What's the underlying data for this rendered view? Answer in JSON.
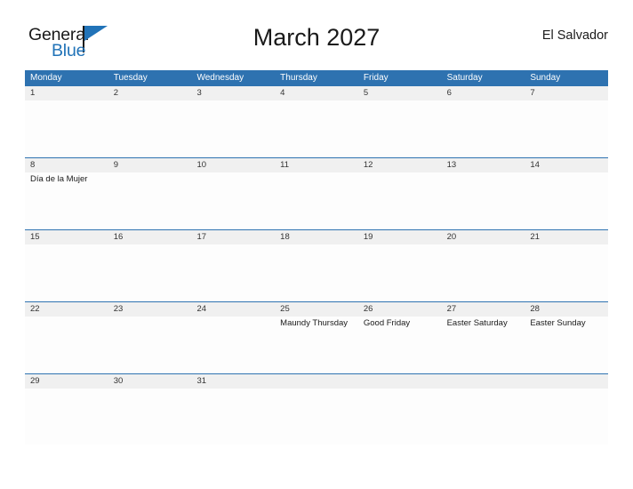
{
  "logo": {
    "word_one": "General",
    "word_two": "Blue",
    "flag_icon": "triangle-flag-icon",
    "color_black": "#1a1a1a",
    "color_blue": "#2173b8"
  },
  "header": {
    "title": "March 2027",
    "country": "El Salvador"
  },
  "calendar": {
    "accent_color": "#2e72b0",
    "date_strip_color": "#f0f0f0",
    "day_names": [
      "Monday",
      "Tuesday",
      "Wednesday",
      "Thursday",
      "Friday",
      "Saturday",
      "Sunday"
    ],
    "weeks": [
      {
        "days": [
          {
            "date": "1",
            "events": []
          },
          {
            "date": "2",
            "events": []
          },
          {
            "date": "3",
            "events": []
          },
          {
            "date": "4",
            "events": []
          },
          {
            "date": "5",
            "events": []
          },
          {
            "date": "6",
            "events": []
          },
          {
            "date": "7",
            "events": []
          }
        ]
      },
      {
        "days": [
          {
            "date": "8",
            "events": [
              "Día de la Mujer"
            ]
          },
          {
            "date": "9",
            "events": []
          },
          {
            "date": "10",
            "events": []
          },
          {
            "date": "11",
            "events": []
          },
          {
            "date": "12",
            "events": []
          },
          {
            "date": "13",
            "events": []
          },
          {
            "date": "14",
            "events": []
          }
        ]
      },
      {
        "days": [
          {
            "date": "15",
            "events": []
          },
          {
            "date": "16",
            "events": []
          },
          {
            "date": "17",
            "events": []
          },
          {
            "date": "18",
            "events": []
          },
          {
            "date": "19",
            "events": []
          },
          {
            "date": "20",
            "events": []
          },
          {
            "date": "21",
            "events": []
          }
        ]
      },
      {
        "days": [
          {
            "date": "22",
            "events": []
          },
          {
            "date": "23",
            "events": []
          },
          {
            "date": "24",
            "events": []
          },
          {
            "date": "25",
            "events": [
              "Maundy Thursday"
            ]
          },
          {
            "date": "26",
            "events": [
              "Good Friday"
            ]
          },
          {
            "date": "27",
            "events": [
              "Easter Saturday"
            ]
          },
          {
            "date": "28",
            "events": [
              "Easter Sunday"
            ]
          }
        ]
      },
      {
        "days": [
          {
            "date": "29",
            "events": []
          },
          {
            "date": "30",
            "events": []
          },
          {
            "date": "31",
            "events": []
          },
          {
            "date": "",
            "events": []
          },
          {
            "date": "",
            "events": []
          },
          {
            "date": "",
            "events": []
          },
          {
            "date": "",
            "events": []
          }
        ]
      }
    ]
  }
}
